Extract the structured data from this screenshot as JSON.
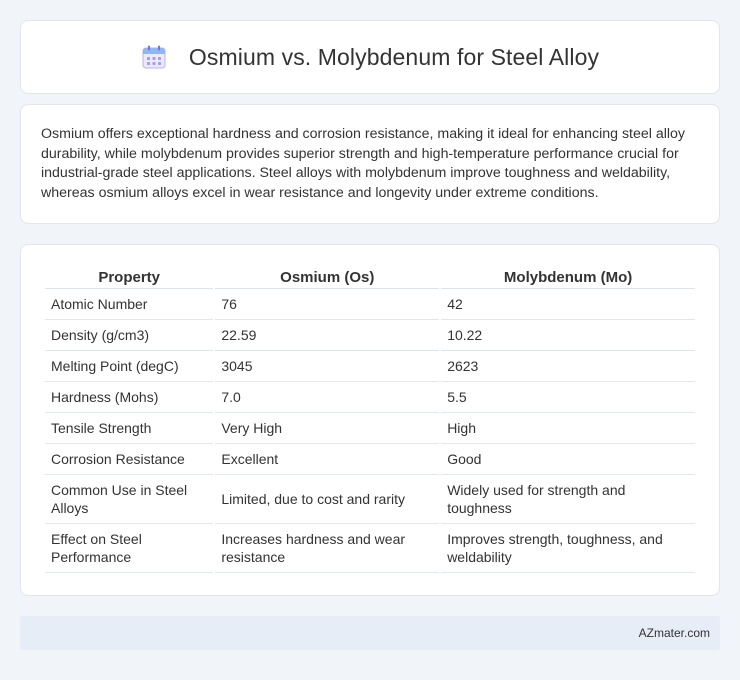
{
  "header": {
    "title": "Osmium vs. Molybdenum for Steel Alloy",
    "icon": "calendar-icon"
  },
  "intro": {
    "text": "Osmium offers exceptional hardness and corrosion resistance, making it ideal for enhancing steel alloy durability, while molybdenum provides superior strength and high-temperature performance crucial for industrial-grade steel applications. Steel alloys with molybdenum improve toughness and weldability, whereas osmium alloys excel in wear resistance and longevity under extreme conditions."
  },
  "table": {
    "headers": [
      "Property",
      "Osmium (Os)",
      "Molybdenum (Mo)"
    ],
    "rows": [
      [
        "Atomic Number",
        "76",
        "42"
      ],
      [
        "Density (g/cm3)",
        "22.59",
        "10.22"
      ],
      [
        "Melting Point (degC)",
        "3045",
        "2623"
      ],
      [
        "Hardness (Mohs)",
        "7.0",
        "5.5"
      ],
      [
        "Tensile Strength",
        "Very High",
        "High"
      ],
      [
        "Corrosion Resistance",
        "Excellent",
        "Good"
      ],
      [
        "Common Use in Steel Alloys",
        "Limited, due to cost and rarity",
        "Widely used for strength and toughness"
      ],
      [
        "Effect on Steel Performance",
        "Increases hardness and wear resistance",
        "Improves strength, toughness, and weldability"
      ]
    ]
  },
  "footer": {
    "text": "AZmater.com"
  },
  "colors": {
    "background": "#f1f4f9",
    "card": "#ffffff",
    "footer": "#e6edf7",
    "icon_accent": "#8a7fd8"
  }
}
